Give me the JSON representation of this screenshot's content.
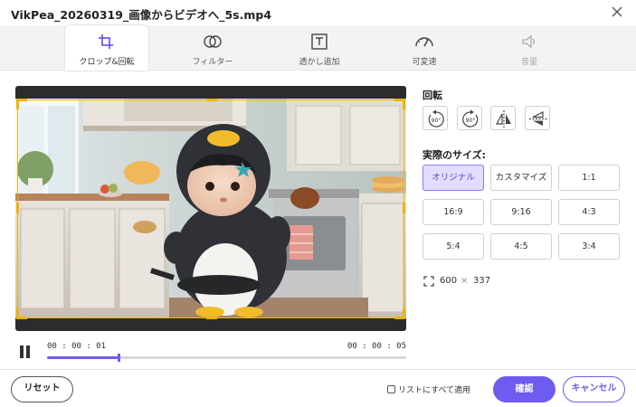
{
  "window": {
    "title": "VikPea_20260319_画像からビデオへ_5s.mp4"
  },
  "tabs": [
    {
      "label": "クロップ&回転",
      "icon": "crop-icon",
      "active": true
    },
    {
      "label": "フィルター",
      "icon": "filter-icon",
      "active": false
    },
    {
      "label": "透かし追加",
      "icon": "watermark-icon",
      "active": false
    },
    {
      "label": "可変速",
      "icon": "speed-icon",
      "active": false
    },
    {
      "label": "音量",
      "icon": "volume-icon",
      "active": false,
      "disabled": true
    }
  ],
  "player": {
    "current_time": "00 : 00 : 01",
    "total_time": "00 : 00 : 05",
    "progress": 0.2
  },
  "rotation": {
    "label": "回転",
    "buttons": [
      {
        "icon": "rotate-left-90-icon",
        "text": "90°"
      },
      {
        "icon": "rotate-right-90-icon",
        "text": "90°"
      },
      {
        "icon": "flip-horizontal-icon"
      },
      {
        "icon": "flip-vertical-icon"
      }
    ]
  },
  "size": {
    "label": "実際のサイズ:",
    "options": [
      "オリジナル",
      "カスタマイズ",
      "1:1",
      "16:9",
      "9:16",
      "4:3",
      "5:4",
      "4:5",
      "3:4"
    ],
    "selected": "オリジナル",
    "width": "600",
    "separator": "×",
    "height": "337"
  },
  "footer": {
    "reset_label": "リセット",
    "apply_all_label": "リストにすべて適用",
    "ok_label": "確認",
    "cancel_label": "キャンセル"
  },
  "colors": {
    "accent": "#6e5cf0",
    "crop_frame": "#f0b400",
    "selected_bg": "#e3ddff"
  }
}
